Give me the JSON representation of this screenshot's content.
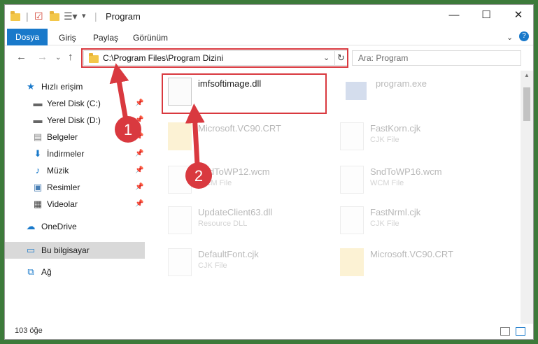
{
  "window": {
    "title": "Program",
    "controls": {
      "minimize": "—",
      "maximize": "☐",
      "close": "✕"
    }
  },
  "ribbon": {
    "tabs": [
      "Dosya",
      "Giriş",
      "Paylaş",
      "Görünüm"
    ]
  },
  "addressbar": {
    "path": "C:\\Program Files\\Program Dizini",
    "search_placeholder": "Ara: Program"
  },
  "sidebar": {
    "items": [
      {
        "label": "Hızlı erişim",
        "icon": "star-icon",
        "pinned": false
      },
      {
        "label": "Yerel Disk (C:)",
        "icon": "drive-icon",
        "pinned": true
      },
      {
        "label": "Yerel Disk (D:)",
        "icon": "drive-icon",
        "pinned": true
      },
      {
        "label": "Belgeler",
        "icon": "documents-icon",
        "pinned": true
      },
      {
        "label": "İndirmeler",
        "icon": "download-icon",
        "pinned": true
      },
      {
        "label": "Müzik",
        "icon": "music-icon",
        "pinned": true
      },
      {
        "label": "Resimler",
        "icon": "pictures-icon",
        "pinned": true
      },
      {
        "label": "Videolar",
        "icon": "video-icon",
        "pinned": true
      },
      {
        "label": "OneDrive",
        "icon": "cloud-icon",
        "pinned": false
      },
      {
        "label": "Bu bilgisayar",
        "icon": "computer-icon",
        "pinned": false
      },
      {
        "label": "Ağ",
        "icon": "network-icon",
        "pinned": false
      }
    ]
  },
  "files": [
    {
      "name": "imfsoftimage.dll",
      "type": "",
      "kind": "dll"
    },
    {
      "name": "program.exe",
      "type": "",
      "kind": "exe"
    },
    {
      "name": "Microsoft.VC90.CRT",
      "type": "",
      "kind": "folder"
    },
    {
      "name": "FastKorn.cjk",
      "type": "CJK File",
      "kind": "doc"
    },
    {
      "name": "SndToWP12.wcm",
      "type": "WCM File",
      "kind": "doc"
    },
    {
      "name": "SndToWP16.wcm",
      "type": "WCM File",
      "kind": "doc"
    },
    {
      "name": "UpdateClient63.dll",
      "type": "Resource DLL",
      "kind": "dll"
    },
    {
      "name": "FastNrml.cjk",
      "type": "CJK File",
      "kind": "doc"
    },
    {
      "name": "DefaultFont.cjk",
      "type": "CJK File",
      "kind": "doc"
    },
    {
      "name": "Microsoft.VC90.CRT",
      "type": "",
      "kind": "folder"
    }
  ],
  "status": {
    "count": "103 öğe"
  },
  "annotations": {
    "step1": "1",
    "step2": "2",
    "color": "#d9393f"
  }
}
